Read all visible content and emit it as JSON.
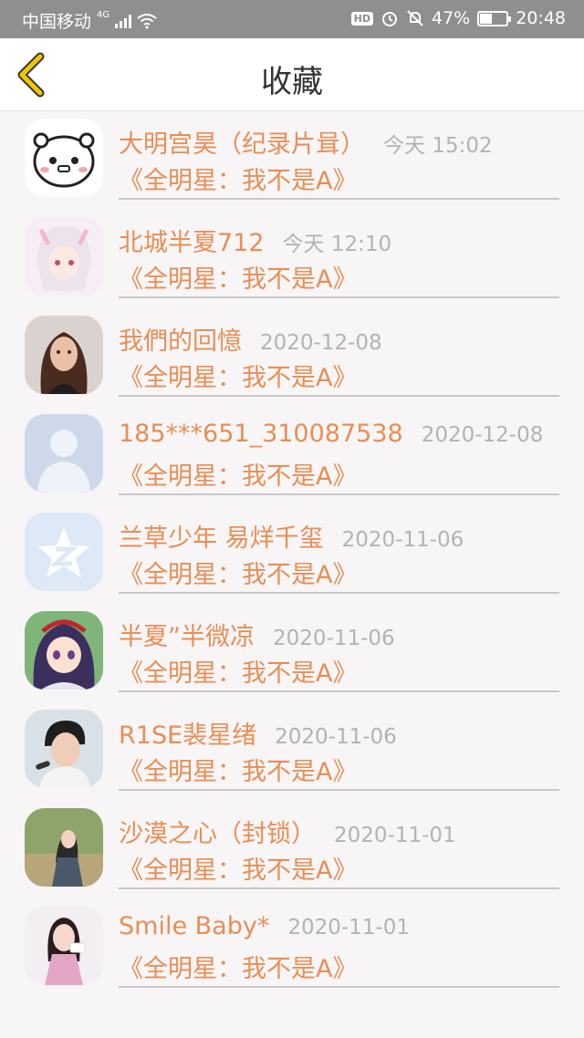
{
  "status_bar": {
    "carrier": "中国移动",
    "network": "4G",
    "battery_percent": "47%",
    "battery_level": 0.47,
    "time": "20:48",
    "hd_label": "HD"
  },
  "header": {
    "title": "收藏",
    "back_icon": "chevron-left-icon",
    "accent_color": "#f2c500"
  },
  "favorites": [
    {
      "name": "大明宫昊（纪录片咠）",
      "time": "今天 15:02",
      "show": "《全明星：我不是A》",
      "avatar": "cute-cartoon-avatar"
    },
    {
      "name": "北城半夏712",
      "time": "今天 12:10",
      "show": "《全明星：我不是A》",
      "avatar": "anime-girl-avatar"
    },
    {
      "name": "我們的回憶",
      "time": "2020-12-08",
      "show": "《全明星：我不是A》",
      "avatar": "woman-photo-avatar"
    },
    {
      "name": "185***651_310087538",
      "time": "2020-12-08",
      "show": "《全明星：我不是A》",
      "avatar": "default-user-avatar"
    },
    {
      "name": "兰草少年 易烊千玺",
      "time": "2020-11-06",
      "show": "《全明星：我不是A》",
      "avatar": "qzone-star-avatar"
    },
    {
      "name": "半夏”半微凉",
      "time": "2020-11-06",
      "show": "《全明星：我不是A》",
      "avatar": "anime-character-avatar"
    },
    {
      "name": "R1SE裴星绪",
      "time": "2020-11-06",
      "show": "《全明星：我不是A》",
      "avatar": "singer-photo-avatar"
    },
    {
      "name": "沙漠之心（封锁）",
      "time": "2020-11-01",
      "show": "《全明星：我不是A》",
      "avatar": "girl-outdoor-avatar"
    },
    {
      "name": "Smile Baby*",
      "time": "2020-11-01",
      "show": "《全明星：我不是A》",
      "avatar": "girl-pink-avatar"
    }
  ],
  "colors": {
    "name_text": "#e88e55",
    "time_text": "#b3b3b3",
    "background": "#f7f5f6",
    "status_bar": "#8f8f8f"
  }
}
